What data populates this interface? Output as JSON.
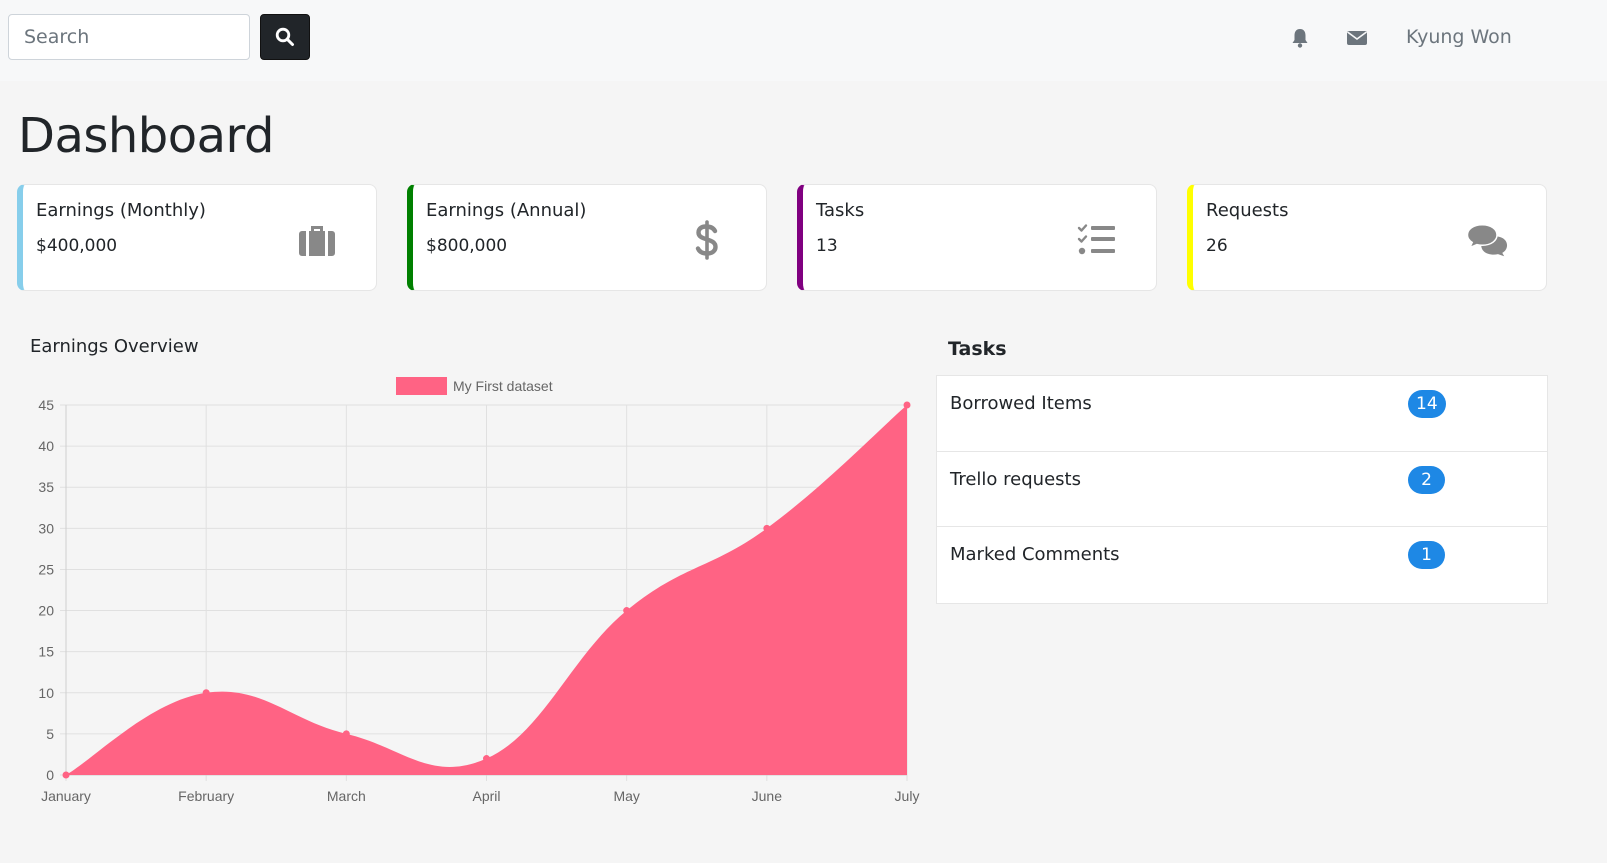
{
  "topbar": {
    "search_placeholder": "Search",
    "user_name": "Kyung Won"
  },
  "page": {
    "title": "Dashboard"
  },
  "cards": [
    {
      "label": "Earnings (Monthly)",
      "value": "$400,000",
      "accent": "#87ceeb",
      "icon": "briefcase-icon"
    },
    {
      "label": "Earnings (Annual)",
      "value": "$800,000",
      "accent": "#008000",
      "icon": "dollar-icon"
    },
    {
      "label": "Tasks",
      "value": "13",
      "accent": "#800080",
      "icon": "tasks-list-icon"
    },
    {
      "label": "Requests",
      "value": "26",
      "accent": "#ffff00",
      "icon": "comments-icon"
    }
  ],
  "earnings": {
    "title": "Earnings Overview"
  },
  "tasks": {
    "title": "Tasks",
    "items": [
      {
        "label": "Borrowed Items",
        "count": "14"
      },
      {
        "label": "Trello requests",
        "count": "2"
      },
      {
        "label": "Marked Comments",
        "count": "1"
      }
    ]
  },
  "chart_data": {
    "type": "area",
    "categories": [
      "January",
      "February",
      "March",
      "April",
      "May",
      "June",
      "July"
    ],
    "series": [
      {
        "name": "My First dataset",
        "values": [
          0,
          10,
          5,
          2,
          20,
          30,
          45
        ],
        "color": "#ff6384"
      }
    ],
    "ylim": [
      0,
      45
    ],
    "yticks": [
      0,
      5,
      10,
      15,
      20,
      25,
      30,
      35,
      40,
      45
    ],
    "grid": true,
    "legend": "top-center"
  }
}
